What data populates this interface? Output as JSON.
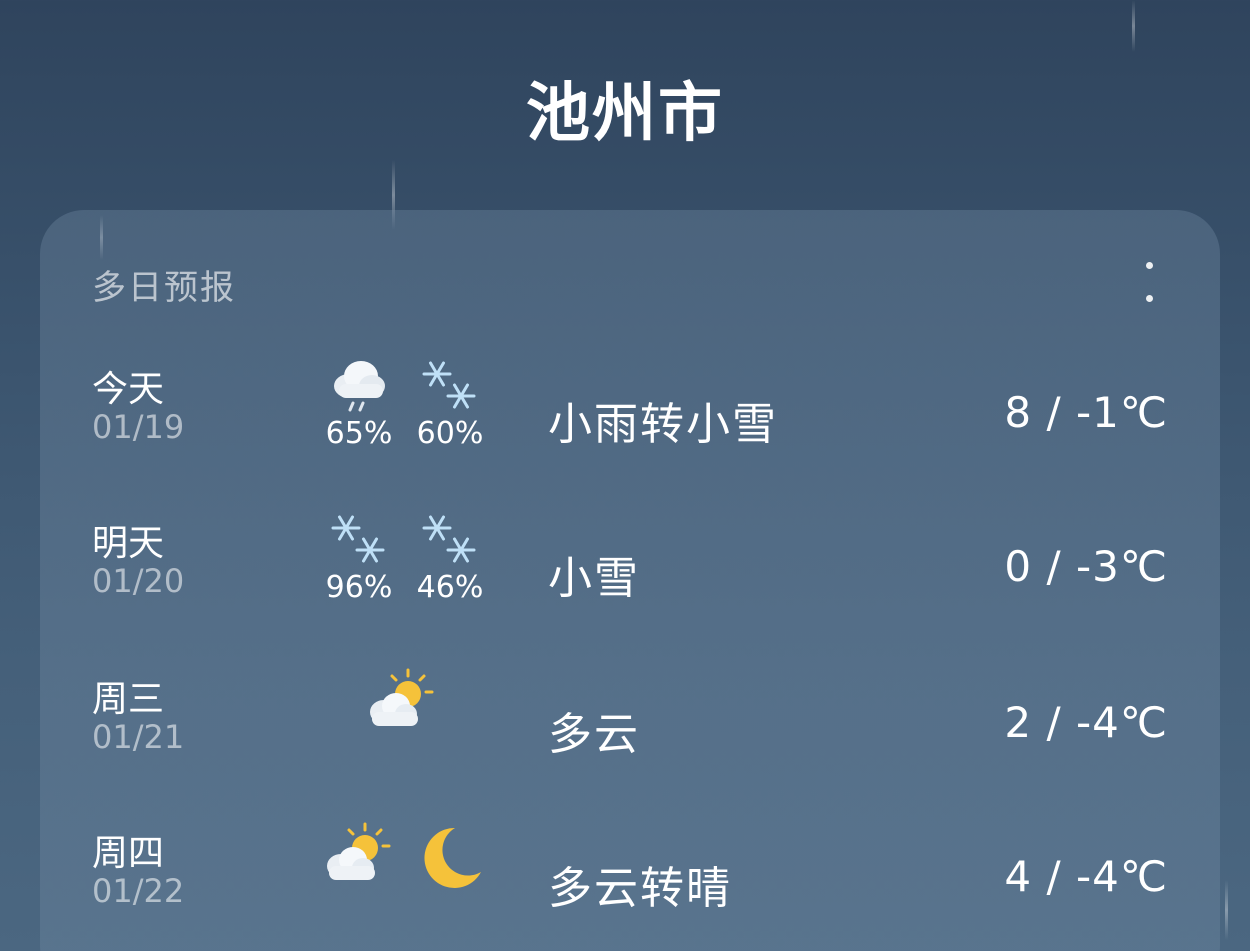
{
  "header": {
    "city": "池州市"
  },
  "card": {
    "title": "多日预报",
    "more_icon": "more-vertical-icon"
  },
  "days": [
    {
      "name": "今天",
      "date": "01/19",
      "day_icon": "cloud-rain-icon",
      "day_precip": "65%",
      "night_icon": "snowflake-icon",
      "night_precip": "60%",
      "condition": "小雨转小雪",
      "temp": "8 / -1℃"
    },
    {
      "name": "明天",
      "date": "01/20",
      "day_icon": "snowflake-icon",
      "day_precip": "96%",
      "night_icon": "snowflake-icon",
      "night_precip": "46%",
      "condition": "小雪",
      "temp": "0 / -3℃"
    },
    {
      "name": "周三",
      "date": "01/21",
      "day_icon": "partly-cloudy-icon",
      "condition": "多云",
      "temp": "2 / -4℃"
    },
    {
      "name": "周四",
      "date": "01/22",
      "day_icon": "partly-cloudy-icon",
      "night_icon": "moon-icon",
      "condition": "多云转晴",
      "temp": "4 / -4℃"
    }
  ],
  "colors": {
    "background_top": "#2f445d",
    "background_bottom": "#4b6781",
    "sun": "#f5c23a",
    "snowflake": "#bfe0f7"
  }
}
